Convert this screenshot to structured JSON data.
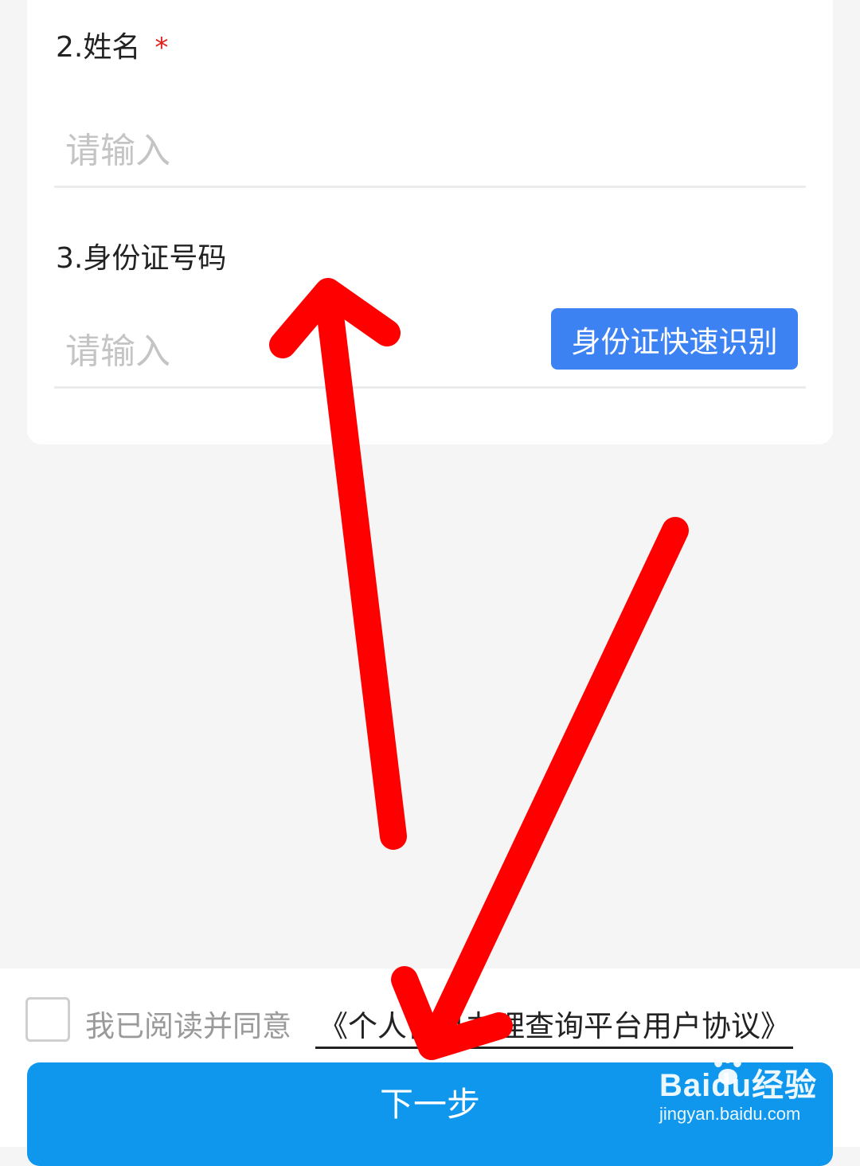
{
  "form": {
    "name_field": {
      "label": "2.姓名",
      "required_mark": "*",
      "placeholder": "请输入",
      "value": ""
    },
    "id_field": {
      "label": "3.身份证号码",
      "placeholder": "请输入",
      "value": "",
      "scan_button_label": "身份证快速识别"
    }
  },
  "footer": {
    "agree_text": "我已阅读并同意",
    "agreement_link": "《个人信息办理查询平台用户协议》",
    "agree_checked": false,
    "next_button_label": "下一步"
  },
  "watermark": {
    "brand": "Baidu经验",
    "domain": "jingyan.baidu.com"
  },
  "colors": {
    "primary_button": "#0e97ec",
    "scan_button": "#3d82f3",
    "required": "#e0201c",
    "annotation_arrow": "#ff0000"
  },
  "icons": [
    "paw-icon",
    "annotation-arrow-up-icon",
    "annotation-arrow-down-icon"
  ]
}
